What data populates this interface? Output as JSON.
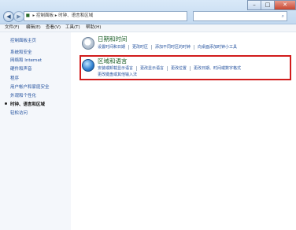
{
  "address_bar": {
    "path": [
      "控制面板",
      "时钟、语言和区域"
    ],
    "search_placeholder": ""
  },
  "window_controls": {
    "minimize": "–",
    "maximize": "□",
    "close": "✕"
  },
  "menu": [
    "文件(F)",
    "编辑(E)",
    "查看(V)",
    "工具(T)",
    "帮助(H)"
  ],
  "sidebar": {
    "items": [
      {
        "label": "控制面板主页",
        "current": false
      },
      {
        "label": "系统和安全",
        "current": false
      },
      {
        "label": "网络和 Internet",
        "current": false
      },
      {
        "label": "硬件和声音",
        "current": false
      },
      {
        "label": "程序",
        "current": false
      },
      {
        "label": "用户帐户和家庭安全",
        "current": false
      },
      {
        "label": "外观和个性化",
        "current": false
      },
      {
        "label": "时钟、语言和区域",
        "current": true
      },
      {
        "label": "轻松访问",
        "current": false
      }
    ]
  },
  "sections": {
    "datetime": {
      "title": "日期和时间",
      "icon": "clock-icon",
      "links": [
        "设置时间和日期",
        "更改时区",
        "添加不同时区的时钟",
        "向桌面添加时钟小工具"
      ]
    },
    "region": {
      "title": "区域和语言",
      "icon": "globe-icon",
      "links_row1": [
        "安装或卸载显示语言",
        "更改显示语言",
        "更改位置",
        "更改日期、时间或数字格式"
      ],
      "links_row2": [
        "更改键盘或其他输入法"
      ]
    }
  },
  "colors": {
    "highlight": "#d11c1c",
    "link": "#1f4e9c",
    "heading": "#1a5e26"
  }
}
